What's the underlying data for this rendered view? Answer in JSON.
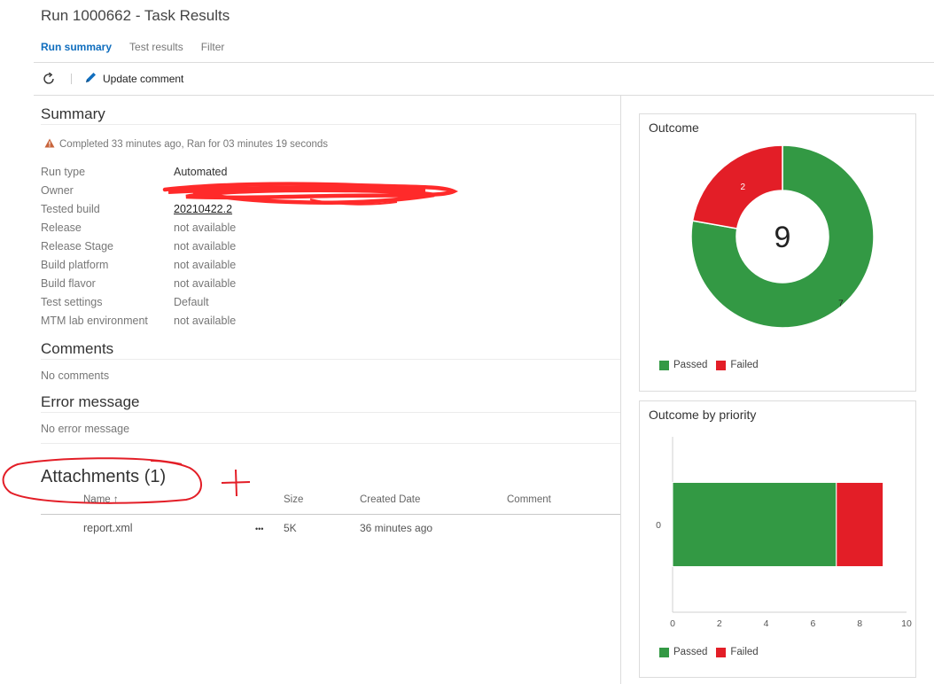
{
  "header": {
    "title": "Run 1000662 - Task Results",
    "tabs": [
      "Run summary",
      "Test results",
      "Filter"
    ]
  },
  "toolbar": {
    "update_comment": "Update comment"
  },
  "summary": {
    "title": "Summary",
    "status": "Completed 33 minutes ago, Ran for 03 minutes 19 seconds",
    "fields": [
      {
        "label": "Run type",
        "value": "Automated"
      },
      {
        "label": "Owner",
        "value": ""
      },
      {
        "label": "Tested build",
        "value": "20210422.2"
      },
      {
        "label": "Release",
        "value": "not available"
      },
      {
        "label": "Release Stage",
        "value": "not available"
      },
      {
        "label": "Build platform",
        "value": "not available"
      },
      {
        "label": "Build flavor",
        "value": "not available"
      },
      {
        "label": "Test settings",
        "value": "Default"
      },
      {
        "label": "MTM lab environment",
        "value": "not available"
      }
    ]
  },
  "comments": {
    "title": "Comments",
    "empty": "No comments"
  },
  "error": {
    "title": "Error message",
    "empty": "No error message"
  },
  "attachments": {
    "title": "Attachments (1)",
    "columns": [
      "Name ↑",
      "Size",
      "Created Date",
      "Comment"
    ],
    "rows": [
      {
        "name": "report.xml",
        "more": "•••",
        "size": "5K",
        "created": "36 minutes ago",
        "comment": ""
      }
    ]
  },
  "colors": {
    "passed": "#339944",
    "failed": "#e31e27",
    "accent": "#106ebe"
  },
  "legend": {
    "passed": "Passed",
    "failed": "Failed"
  },
  "outcome_card": {
    "title": "Outcome",
    "total": "9"
  },
  "priority_card": {
    "title": "Outcome by priority"
  },
  "chart_data": [
    {
      "type": "pie",
      "title": "Outcome",
      "categories": [
        "Passed",
        "Failed"
      ],
      "values": [
        7,
        2
      ],
      "center_label": "9"
    },
    {
      "type": "bar",
      "orientation": "horizontal",
      "stacked": true,
      "title": "Outcome by priority",
      "categories": [
        "0"
      ],
      "series": [
        {
          "name": "Passed",
          "values": [
            7
          ]
        },
        {
          "name": "Failed",
          "values": [
            2
          ]
        }
      ],
      "xlim": [
        0,
        10
      ],
      "xticks": [
        0,
        2,
        4,
        6,
        8,
        10
      ]
    }
  ]
}
